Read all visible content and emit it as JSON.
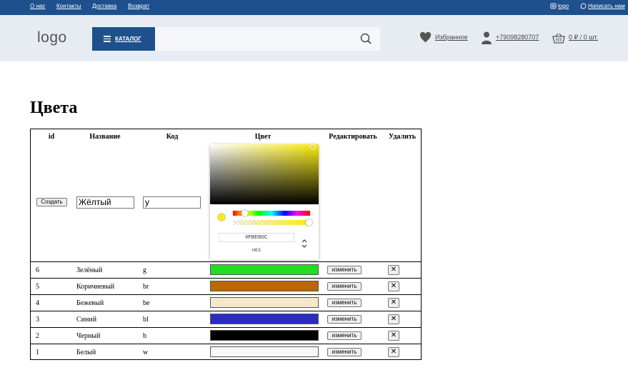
{
  "topbar": {
    "links": [
      "О нас",
      "Контакты",
      "Доставка",
      "Возврат"
    ],
    "instagram": "logo",
    "whatsapp": "Написать нам"
  },
  "header": {
    "logo": "logo",
    "catalog": "КАТАЛОГ",
    "search_value": "",
    "favorites": "Избранное",
    "phone": "+79098280707",
    "cart": "0 ₽ / 0 шт."
  },
  "page": {
    "title": "Цвета"
  },
  "table": {
    "headers": {
      "id": "id",
      "name": "Название",
      "code": "Код",
      "color": "Цвет",
      "edit": "Редактировать",
      "delete": "Удалить"
    },
    "create_row": {
      "create_label": "Создать",
      "name_value": "Жёлтый",
      "code_value": "y"
    },
    "rows": [
      {
        "id": "6",
        "name": "Зелёный",
        "code": "g",
        "color": "#22dd22",
        "edit": "изменить",
        "delete": "✕"
      },
      {
        "id": "5",
        "name": "Коричневый",
        "code": "br",
        "color": "#bd6604",
        "edit": "изменить",
        "delete": "✕"
      },
      {
        "id": "4",
        "name": "Бежевый",
        "code": "be",
        "color": "#f5e9c9",
        "edit": "изменить",
        "delete": "✕"
      },
      {
        "id": "3",
        "name": "Синий",
        "code": "bl",
        "color": "#2a2dc2",
        "edit": "изменить",
        "delete": "✕"
      },
      {
        "id": "2",
        "name": "Черный",
        "code": "b",
        "color": "#050000",
        "edit": "изменить",
        "delete": "✕"
      },
      {
        "id": "1",
        "name": "Белый",
        "code": "w",
        "color": "#f7f7f7",
        "edit": "изменить",
        "delete": "✕"
      }
    ]
  },
  "picker": {
    "hex_value": "#FBEB0C",
    "mode_label": "HEX",
    "current_color": "#fbeb0c"
  },
  "colors": {
    "brand": "#1d508c",
    "header_bg": "#e7ecf3"
  }
}
